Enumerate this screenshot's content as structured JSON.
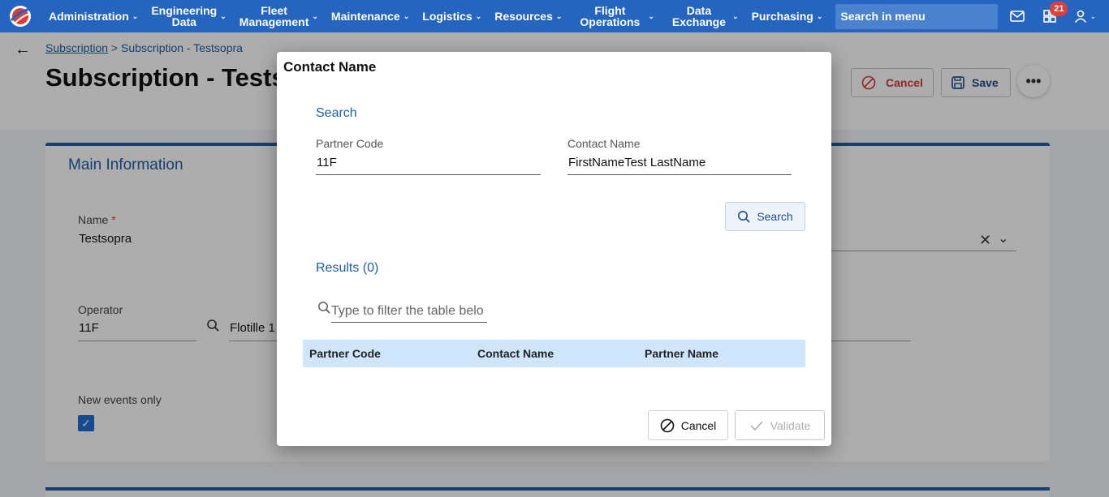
{
  "nav": {
    "items": [
      {
        "label": "Administration"
      },
      {
        "line1": "Engineering",
        "line2": "Data"
      },
      {
        "line1": "Fleet",
        "line2": "Management"
      },
      {
        "label": "Maintenance"
      },
      {
        "label": "Logistics"
      },
      {
        "label": "Resources"
      },
      {
        "line1": "Flight",
        "line2": "Operations"
      },
      {
        "line1": "Data",
        "line2": "Exchange"
      },
      {
        "label": "Purchasing"
      }
    ],
    "search_placeholder": "Search in menu",
    "notification_count": "21"
  },
  "page": {
    "breadcrumb_link": "Subscription",
    "breadcrumb_sep": " > ",
    "breadcrumb_current": "Subscription - Testsopra",
    "title": "Subscription - Testsopra",
    "cancel_label": "Cancel",
    "save_label": "Save",
    "more_label": "•••"
  },
  "main_info": {
    "title": "Main Information",
    "name_label": "Name",
    "name_required": "*",
    "name_value": "Testsopra",
    "operator_label": "Operator",
    "operator_value": "11F",
    "operator_name_value": "Flotille 1",
    "new_events_label": "New events only",
    "new_events_checked": true
  },
  "modal": {
    "title": "Contact Name",
    "search_section": "Search",
    "partner_code_label": "Partner Code",
    "partner_code_value": "11F",
    "contact_name_label": "Contact Name",
    "contact_name_value": "FirstNameTest LastName",
    "search_button": "Search",
    "results_label": "Results (0)",
    "filter_placeholder": "Type to filter the table belo",
    "columns": [
      "Partner Code",
      "Contact Name",
      "Partner Name"
    ],
    "cancel_button": "Cancel",
    "validate_button": "Validate"
  },
  "colors": {
    "brand_blue": "#2565c0",
    "accent_blue": "#1f5ea8",
    "danger_red": "#d23a3a",
    "table_header": "#cfe5fb"
  }
}
